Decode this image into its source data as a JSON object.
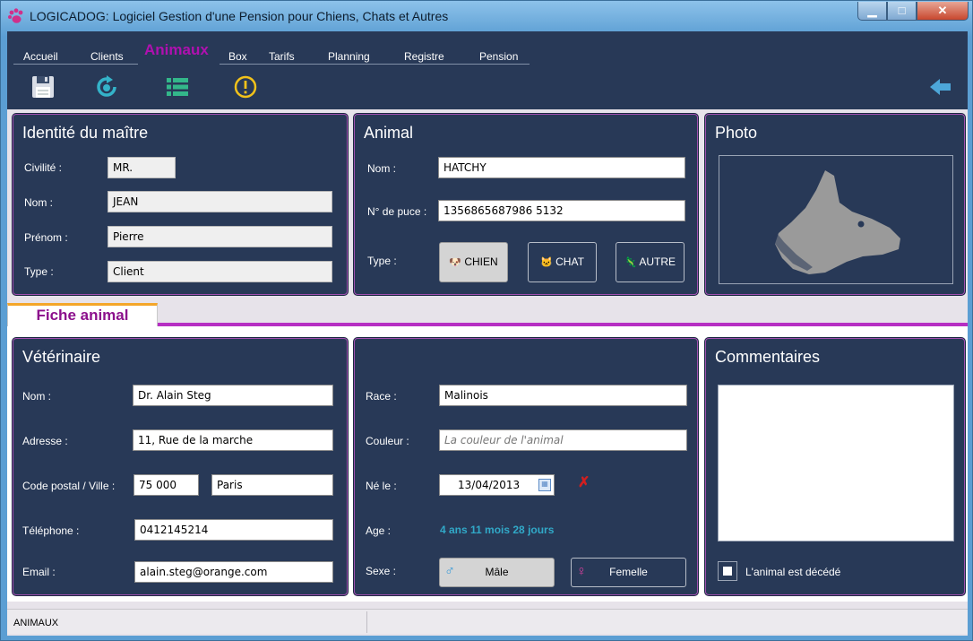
{
  "window": {
    "title": "LOGICADOG: Logiciel Gestion d'une Pension pour Chiens, Chats et  Autres",
    "min_glyph": "▁",
    "max_glyph": "□",
    "close_glyph": "✕"
  },
  "menu": {
    "tabs": [
      "Accueil",
      "Clients",
      "Animaux",
      "Box",
      "Tarifs",
      "Planning",
      "Registre",
      "Pension"
    ],
    "active": "Animaux"
  },
  "toolbar": {
    "icons": [
      "save-icon",
      "refresh-icon",
      "list-icon",
      "warning-icon",
      "back-arrow-icon"
    ]
  },
  "owner": {
    "title": "Identité du maître",
    "civilite_label": "Civilité :",
    "civilite": "MR.",
    "nom_label": "Nom :",
    "nom": "JEAN",
    "prenom_label": "Prénom :",
    "prenom": "Pierre",
    "type_label": "Type :",
    "type": "Client"
  },
  "animal": {
    "title": "Animal",
    "nom_label": "Nom :",
    "nom": "HATCHY",
    "puce_label": "N° de puce :",
    "puce": "1356865687986 5132",
    "type_label": "Type :",
    "types": [
      "CHIEN",
      "CHAT",
      "AUTRE"
    ],
    "selected_type": "CHIEN"
  },
  "photo": {
    "title": "Photo"
  },
  "fiche_tab": {
    "label": "Fiche animal"
  },
  "vet": {
    "title": "Vétérinaire",
    "nom_label": "Nom :",
    "nom": "Dr. Alain Steg",
    "adresse_label": "Adresse :",
    "adresse": "11, Rue de la marche",
    "cp_label": "Code postal / Ville :",
    "cp": "75 000",
    "ville": "Paris",
    "tel_label": "Téléphone :",
    "tel": "0412145214",
    "email_label": "Email :",
    "email": "alain.steg@orange.com"
  },
  "details": {
    "race_label": "Race :",
    "race": "Malinois",
    "couleur_label": "Couleur :",
    "couleur_placeholder": "La couleur de l'animal",
    "ne_label": "Né le :",
    "ne": "13/04/2013",
    "age_label": "Age :",
    "age": "4 ans 11 mois 28 jours",
    "sexe_label": "Sexe :",
    "sexe_options": [
      "Mâle",
      "Femelle"
    ],
    "selected_sexe": "Mâle"
  },
  "comments": {
    "title": "Commentaires",
    "deceased_label": "L'animal est décédé",
    "deceased": false
  },
  "status": {
    "text": "ANIMAUX"
  },
  "colors": {
    "panel_bg": "#283957",
    "active_tab": "#b010b0",
    "age_text": "#31a9c8",
    "fiche_tab_text": "#8c0f8c"
  }
}
